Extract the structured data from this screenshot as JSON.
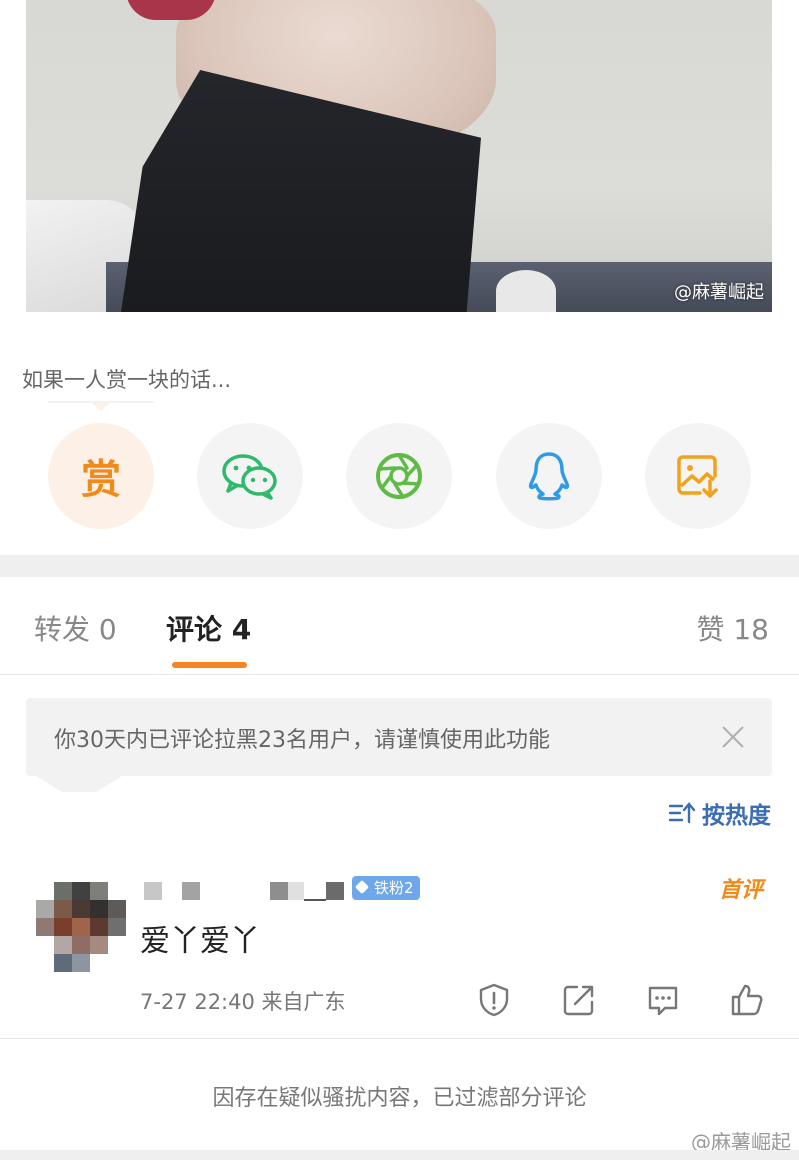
{
  "post": {
    "image_watermark": "@麻薯崛起"
  },
  "reward": {
    "prompt": "如果一人赏一块的话...",
    "reward_label": "赏"
  },
  "share_icons": [
    "reward-icon",
    "wechat-icon",
    "moments-icon",
    "qq-icon",
    "save-image-icon"
  ],
  "tabs": {
    "repost": "转发 0",
    "comment": "评论 4",
    "like": "赞 18"
  },
  "notice": {
    "text": "你30天内已评论拉黑23名用户，请谨慎使用此功能"
  },
  "sort": {
    "label": "按热度"
  },
  "comment": {
    "badge": "铁粉2",
    "first_tag": "首评",
    "text": "爱丫爱丫",
    "meta": "7-27 22:40 来自广东"
  },
  "filter_note": "因存在疑似骚扰内容，已过滤部分评论",
  "bottom_watermark": "@麻薯崛起",
  "colors": {
    "accent_orange": "#f5851f",
    "link_blue": "#3a6db3",
    "badge_blue": "#6fa8ea"
  }
}
